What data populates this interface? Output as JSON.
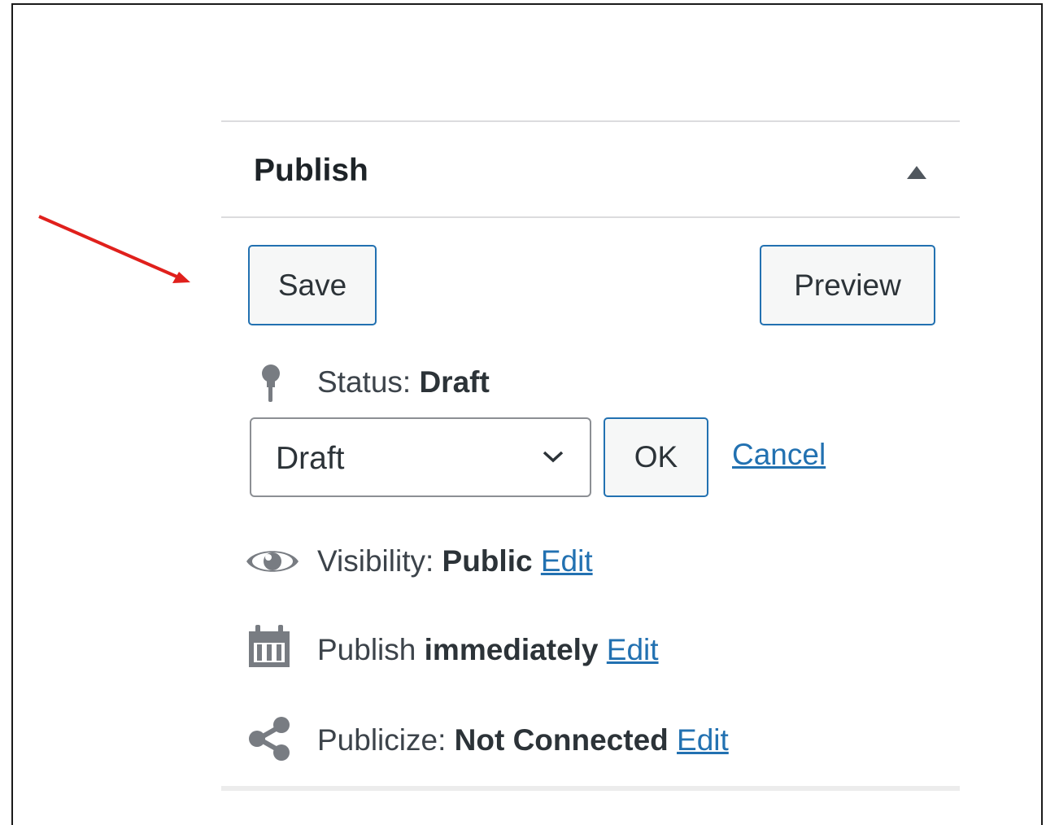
{
  "panel": {
    "title": "Publish",
    "toggle_icon": "triangle-up-icon"
  },
  "actions": {
    "save_label": "Save",
    "preview_label": "Preview"
  },
  "status": {
    "icon": "pin-icon",
    "label": "Status: ",
    "value": "Draft",
    "select_value": "Draft",
    "ok_label": "OK",
    "cancel_label": "Cancel"
  },
  "visibility": {
    "icon": "eye-icon",
    "label": "Visibility: ",
    "value": "Public",
    "edit_label": "Edit"
  },
  "schedule": {
    "icon": "calendar-icon",
    "label": "Publish ",
    "value": "immediately",
    "edit_label": "Edit"
  },
  "publicize": {
    "icon": "share-icon",
    "label": "Publicize: ",
    "value": "Not Connected",
    "edit_label": "Edit"
  },
  "colors": {
    "accent": "#2271b1",
    "annotation_arrow": "#e0201c"
  }
}
